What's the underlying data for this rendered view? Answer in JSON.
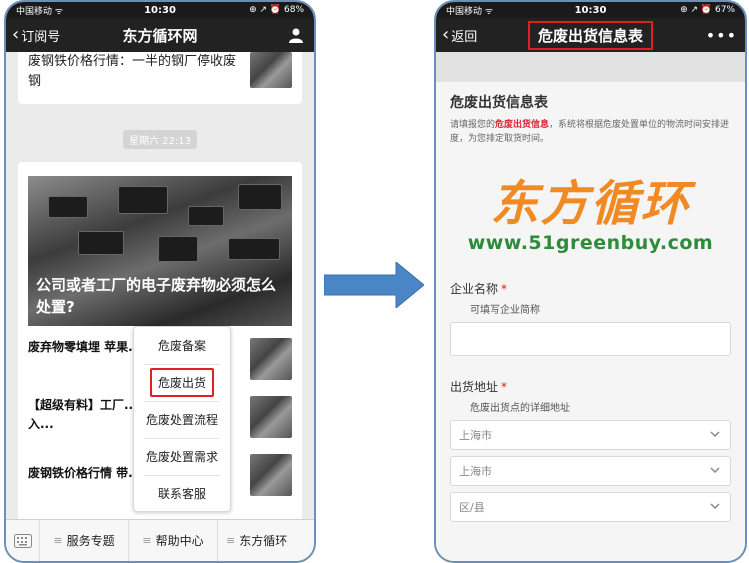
{
  "left_phone": {
    "status": {
      "carrier": "中国移动 ᯤ",
      "time": "10:30",
      "right": "⊕ ↗ ⏰ 68%"
    },
    "nav": {
      "back_label": "订阅号",
      "title": "东方循环网"
    },
    "top_article": "废钢铁价格行情：一半的钢厂停收废钢",
    "date_label": "星期六 22:13",
    "hero_caption": "公司或者工厂的电子废弃物必须怎么处置?",
    "news": [
      {
        "text": "废弃物零填埋 苹果... 蟹并非偶然"
      },
      {
        "text": "【超级有料】工厂... 生回收商 快来加入..."
      },
      {
        "text": "废钢铁价格行情 带..."
      }
    ],
    "popup_menu": [
      "危废备案",
      "危废出货",
      "危废处置流程",
      "危废处置需求",
      "联系客服"
    ],
    "bottom_menu": [
      "服务专题",
      "帮助中心",
      "东方循环"
    ]
  },
  "right_phone": {
    "status": {
      "carrier": "中国移动 ᯤ",
      "time": "10:30",
      "right": "⊕ ↗ ⏰ 67%"
    },
    "nav": {
      "back_label": "返回",
      "title": "危废出货信息表",
      "more": "•••"
    },
    "form_title": "危废出货信息表",
    "desc_before": "请填报您的",
    "desc_highlight": "危废出货信息",
    "desc_after": "，系统将根据危废处置单位的物流时间安排进度，为您排定取货时间。",
    "logo_cn": "东方循环",
    "logo_url": "www.51greenbuy.com",
    "company_label": "企业名称",
    "company_hint": "可填写企业简称",
    "address_label": "出货地址",
    "address_hint": "危废出货点的详细地址",
    "province": "上海市",
    "city": "上海市",
    "district_placeholder": "区/县"
  },
  "colors": {
    "frame": "#6a8fb8",
    "highlight_red": "#e0201c",
    "logo_orange": "#f08a24",
    "logo_green": "#2e8b3a",
    "arrow_blue": "#4a86c5"
  }
}
